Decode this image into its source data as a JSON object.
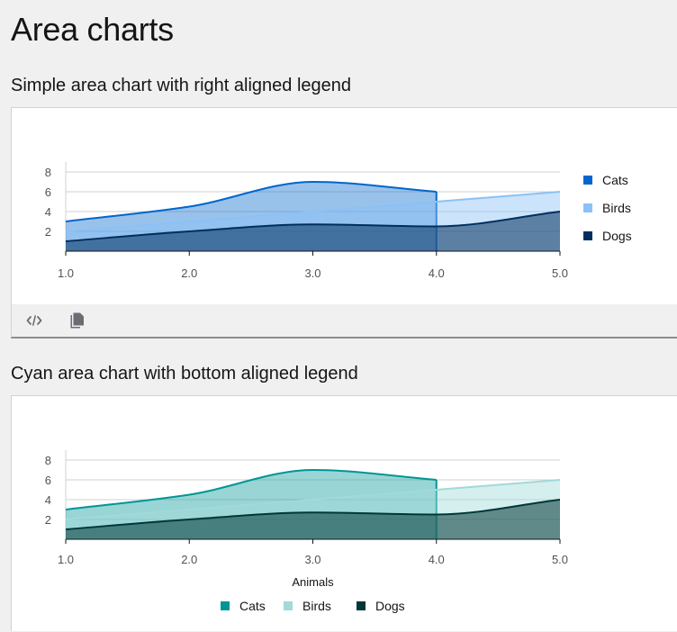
{
  "page": {
    "title": "Area charts"
  },
  "toolbar": {
    "code_icon": "code-icon",
    "copy_icon": "copy-icon"
  },
  "chart_data": [
    {
      "type": "area",
      "title": "Simple area chart with right aligned legend",
      "x": [
        1,
        2,
        3,
        4,
        5
      ],
      "x_tick_labels": [
        "1.0",
        "2.0",
        "3.0",
        "4.0",
        "5.0"
      ],
      "y_tick_labels": [
        "2",
        "4",
        "6",
        "8"
      ],
      "y_ticks": [
        2,
        4,
        6,
        8
      ],
      "ylim": [
        0,
        9
      ],
      "xlabel": "",
      "grid": true,
      "legend_position": "right",
      "series": [
        {
          "name": "Cats",
          "x": [
            1,
            2,
            3,
            4
          ],
          "values": [
            3,
            4.5,
            7,
            6
          ],
          "color": "#06c"
        },
        {
          "name": "Birds",
          "x": [
            1,
            2,
            3,
            4,
            5
          ],
          "values": [
            2,
            3,
            4,
            5,
            6
          ],
          "color": "#8bc1f7"
        },
        {
          "name": "Dogs",
          "x": [
            1,
            2,
            3,
            4,
            5
          ],
          "values": [
            1,
            2,
            2.7,
            2.5,
            4
          ],
          "color": "#002f5d"
        }
      ]
    },
    {
      "type": "area",
      "title": "Cyan area chart with bottom aligned legend",
      "x": [
        1,
        2,
        3,
        4,
        5
      ],
      "x_tick_labels": [
        "1.0",
        "2.0",
        "3.0",
        "4.0",
        "5.0"
      ],
      "y_tick_labels": [
        "2",
        "4",
        "6",
        "8"
      ],
      "y_ticks": [
        2,
        4,
        6,
        8
      ],
      "ylim": [
        0,
        9
      ],
      "xlabel": "Animals",
      "grid": true,
      "legend_position": "bottom",
      "series": [
        {
          "name": "Cats",
          "x": [
            1,
            2,
            3,
            4
          ],
          "values": [
            3,
            4.5,
            7,
            6
          ],
          "color": "#009596"
        },
        {
          "name": "Birds",
          "x": [
            1,
            2,
            3,
            4,
            5
          ],
          "values": [
            2,
            3,
            4,
            5,
            6
          ],
          "color": "#a2d9d9"
        },
        {
          "name": "Dogs",
          "x": [
            1,
            2,
            3,
            4,
            5
          ],
          "values": [
            1,
            2,
            2.7,
            2.5,
            4
          ],
          "color": "#003737"
        }
      ]
    }
  ]
}
